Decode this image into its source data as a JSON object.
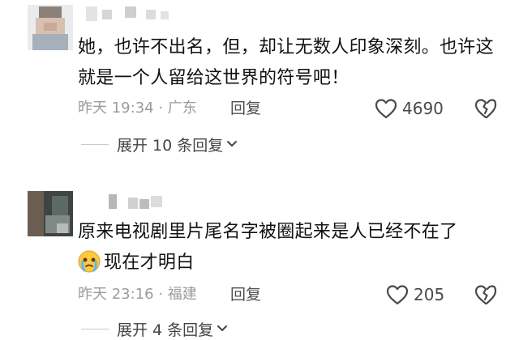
{
  "comments": [
    {
      "text": "她，也许不出名，但，却让无数人印象深刻。也许这就是一个人留给这世界的符号吧！",
      "time": "昨天 19:34 · 广东",
      "reply_label": "回复",
      "likes": "4690",
      "expand_label": "展开 10 条回复"
    },
    {
      "text": "原来电视剧里片尾名字被圈起来是人已经不在了",
      "text_line2": "现在才明白",
      "emoji": "crying-face",
      "time": "昨天 23:16 · 福建",
      "reply_label": "回复",
      "likes": "205",
      "expand_label": "展开 4 条回复"
    }
  ],
  "colors": {
    "text": "#111111",
    "meta": "#9b9b9b",
    "icon": "#4a4a4a"
  },
  "icons": [
    "heart-outline",
    "broken-heart",
    "chevron-down",
    "crying-face-emoji"
  ]
}
